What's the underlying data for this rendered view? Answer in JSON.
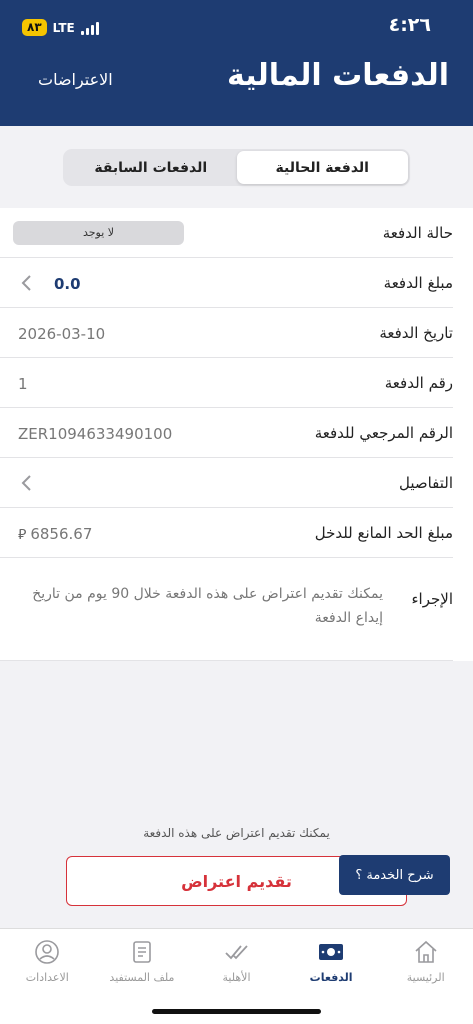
{
  "status_bar": {
    "time": "٤:٢٦",
    "battery": "٨٣",
    "network": "LTE"
  },
  "header": {
    "title": "الدفعات المالية",
    "objections_link": "الاعتراضات"
  },
  "segments": {
    "current": "الدفعة الحالية",
    "previous": "الدفعات السابقة"
  },
  "details": {
    "status_label": "حالة الدفعة",
    "status_value": "لا يوجد",
    "amount_label": "مبلغ الدفعة",
    "amount_value": "0.0",
    "date_label": "تاريخ الدفعة",
    "date_value": "2026-03-10",
    "number_label": "رقم الدفعة",
    "number_value": "1",
    "reference_label": "الرقم المرجعي للدفعة",
    "reference_value": "ZER1094633490100",
    "details_label": "التفاصيل",
    "income_label": "مبلغ الحد المانع للدخل",
    "income_value": "6856.67",
    "income_currency": "⃁",
    "action_label": "الإجراء",
    "action_value": "يمكنك تقديم اعتراض على هذه الدفعة خلال 90 يوم من تاريخ إيداع الدفعة"
  },
  "footer": {
    "hint": "يمكنك تقديم اعتراض على هذه الدفعة",
    "submit_label": "تقديم اعتراض",
    "explain_label": "شرح الخدمة ؟"
  },
  "tabbar": {
    "home": "الرئيسية",
    "payments": "الدفعات",
    "eligibility": "الأهلية",
    "profile": "ملف المستفيد",
    "settings": "الاعدادات"
  },
  "colors": {
    "primary": "#1e3c72",
    "danger": "#d6323a"
  }
}
